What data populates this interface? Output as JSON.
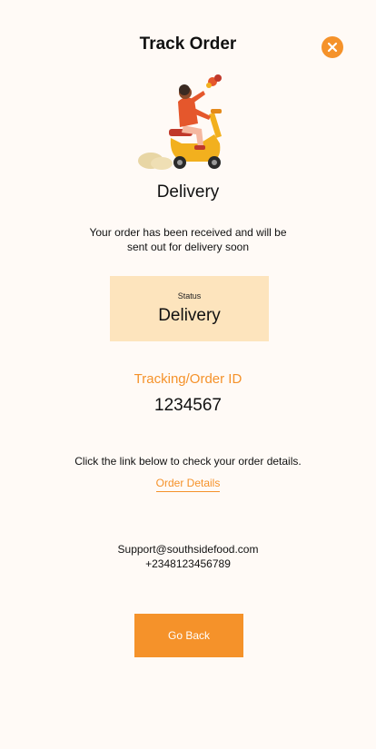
{
  "header": {
    "title": "Track Order"
  },
  "icons": {
    "close": "close-icon",
    "illustration": "delivery-scooter-illustration"
  },
  "delivery": {
    "heading": "Delivery",
    "message": "Your order has been received and will be sent out for delivery soon"
  },
  "status": {
    "label": "Status",
    "value": "Delivery"
  },
  "tracking": {
    "label": "Tracking/Order ID",
    "id": "1234567"
  },
  "details": {
    "instruction": "Click the link below to check your order details.",
    "link_label": "Order Details"
  },
  "support": {
    "email": "Support@southsidefood.com",
    "phone": "+2348123456789"
  },
  "actions": {
    "go_back_label": "Go Back"
  },
  "colors": {
    "accent": "#f5922a",
    "status_bg": "#fde4bd",
    "background": "#fffaf6"
  }
}
